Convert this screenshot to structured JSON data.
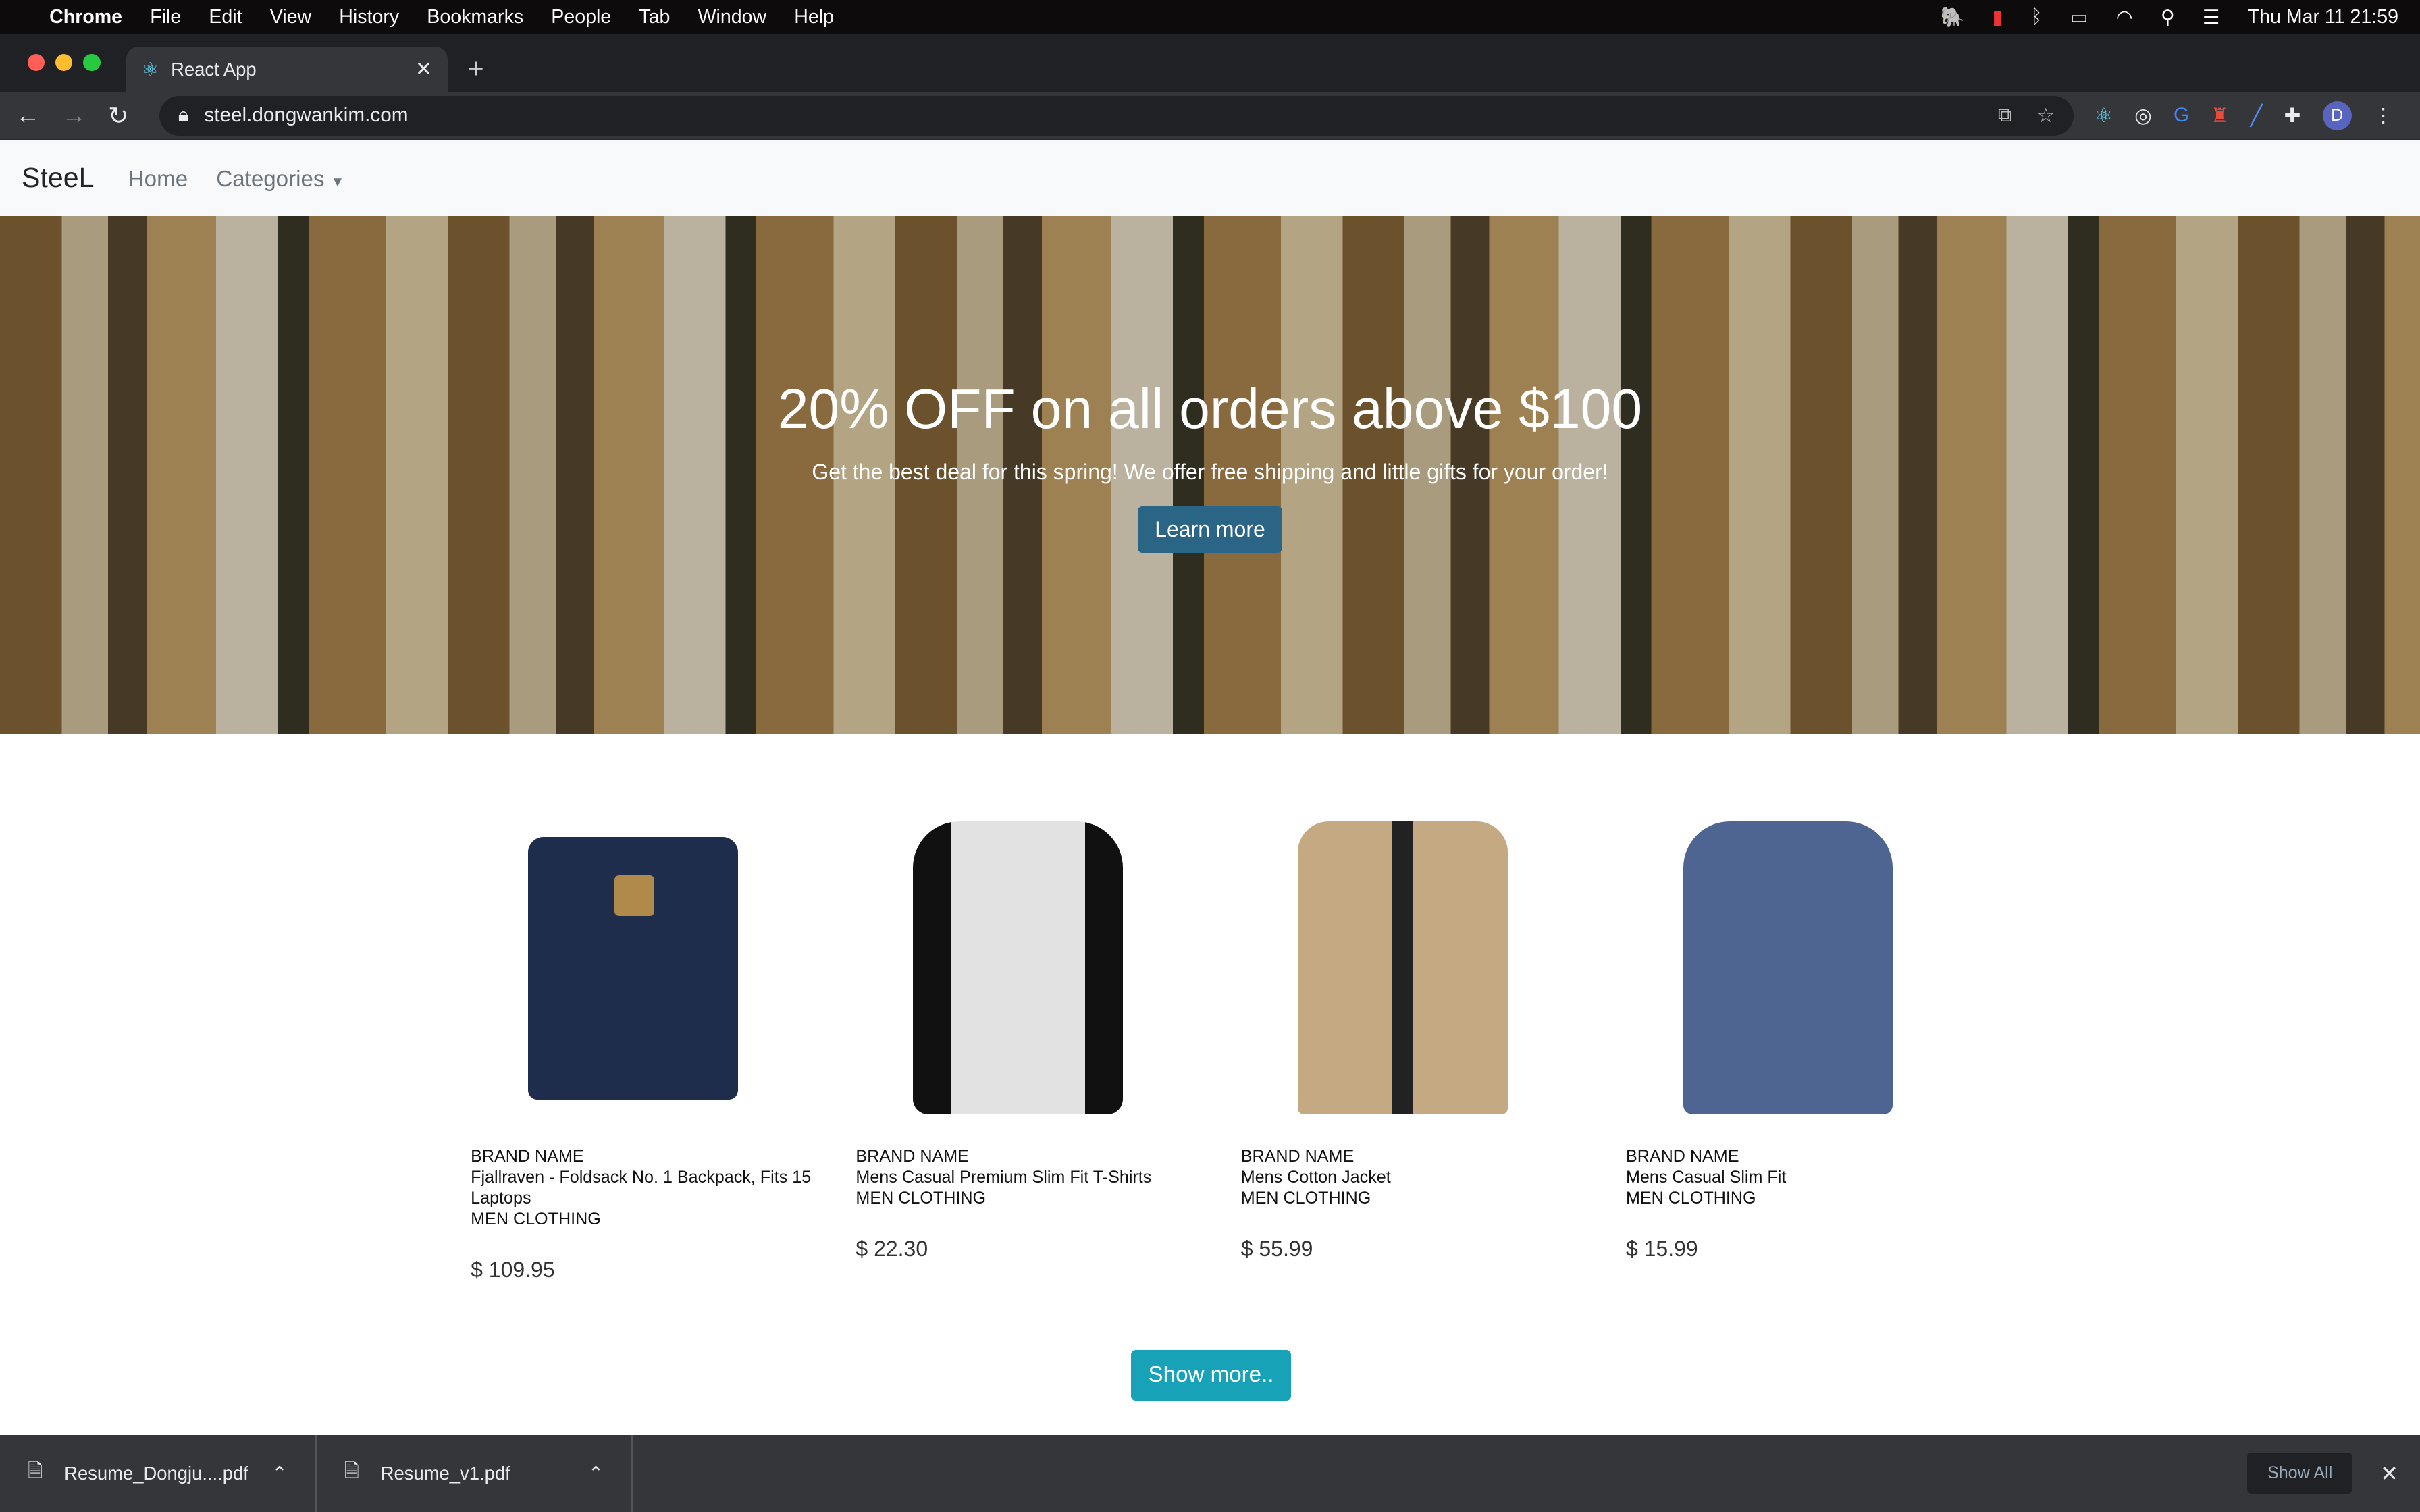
{
  "menubar": {
    "app": "Chrome",
    "items": [
      "File",
      "Edit",
      "View",
      "History",
      "Bookmarks",
      "People",
      "Tab",
      "Window",
      "Help"
    ],
    "clock": "Thu Mar 11  21:59"
  },
  "browser": {
    "tab_title": "React App",
    "url": "steel.dongwankim.com",
    "profile_initial": "D"
  },
  "navbar": {
    "brand": "SteeL",
    "home": "Home",
    "categories": "Categories"
  },
  "hero": {
    "title": "20% OFF on all orders above $100",
    "subtitle": "Get the best deal for this spring! We offer free shipping and little gifts for your order!",
    "button": "Learn more"
  },
  "products": [
    {
      "brand": "BRAND NAME",
      "name": "Fjallraven - Foldsack No. 1 Backpack, Fits 15 Laptops",
      "category": "MEN CLOTHING",
      "price": "$ 109.95"
    },
    {
      "brand": "BRAND NAME",
      "name": "Mens Casual Premium Slim Fit T-Shirts",
      "category": "MEN CLOTHING",
      "price": "$ 22.30"
    },
    {
      "brand": "BRAND NAME",
      "name": "Mens Cotton Jacket",
      "category": "MEN CLOTHING",
      "price": "$ 55.99"
    },
    {
      "brand": "BRAND NAME",
      "name": "Mens Casual Slim Fit",
      "category": "MEN CLOTHING",
      "price": "$ 15.99"
    }
  ],
  "show_more": "Show more..",
  "downloads": {
    "files": [
      "Resume_Dongju....pdf",
      "Resume_v1.pdf"
    ],
    "show_all": "Show All"
  }
}
